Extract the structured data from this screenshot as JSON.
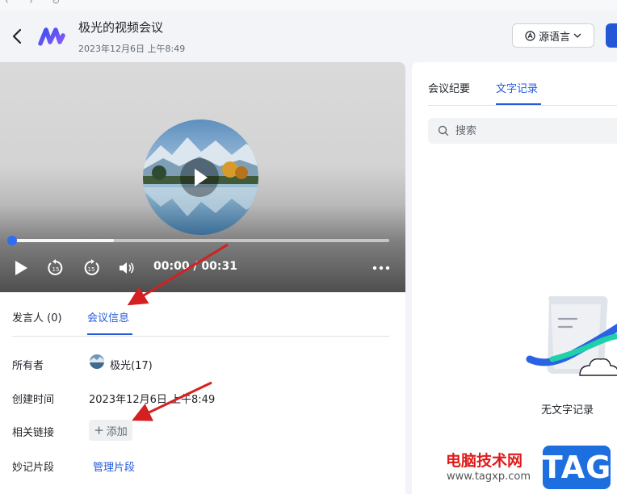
{
  "header": {
    "title": "极光的视频会议",
    "subtitle": "2023年12月6日 上午8:49",
    "language_button": "源语言"
  },
  "player": {
    "time": "00:00 / 00:31",
    "progress": 0.0,
    "buffered": 0.27
  },
  "left_tabs": [
    {
      "label": "发言人 (0)",
      "active": false
    },
    {
      "label": "会议信息",
      "active": true
    }
  ],
  "info": {
    "owner_label": "所有者",
    "owner_value": "极光(17)",
    "created_label": "创建时间",
    "created_value": "2023年12月6日 上午8:49",
    "links_label": "相关链接",
    "add_label": "添加",
    "clips_label": "妙记片段",
    "clips_link": "管理片段"
  },
  "right_tabs": [
    {
      "label": "会议纪要",
      "active": false
    },
    {
      "label": "文字记录",
      "active": true
    }
  ],
  "search": {
    "placeholder": "搜索",
    "value": ""
  },
  "empty_state": {
    "text": "无文字记录"
  },
  "watermark": {
    "site_name": "电脑技术网",
    "url": "www.tagxp.com",
    "badge": "TAG"
  },
  "colors": {
    "accent": "#245bdb",
    "brand_badge": "#1d6fe0",
    "progress_knob": "#2c6ff0",
    "arrow": "#d42020"
  }
}
